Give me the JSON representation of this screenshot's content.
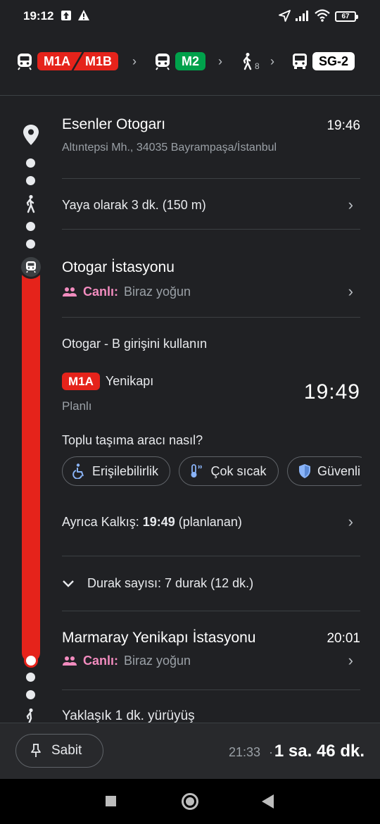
{
  "status_bar": {
    "time": "19:12",
    "battery": "67"
  },
  "route_summary": {
    "lines": [
      {
        "type": "metro",
        "labels": [
          "M1A",
          "M1B"
        ],
        "color": "#e5231b"
      },
      {
        "type": "metro",
        "labels": [
          "M2"
        ],
        "color": "#00a14b"
      },
      {
        "type": "walk",
        "minutes": "8"
      },
      {
        "type": "bus",
        "labels": [
          "SG-2"
        ],
        "color": "#ffffff"
      }
    ]
  },
  "origin": {
    "name": "Esenler Otogarı",
    "address": "Altıntepsi Mh., 34035 Bayrampaşa/İstanbul",
    "time": "19:46"
  },
  "walk_step": {
    "text": "Yaya olarak 3 dk. (150 m)"
  },
  "station": {
    "name": "Otogar İstasyonu",
    "live_label": "Canlı:",
    "live_value": "Biraz yoğun",
    "entrance_note": "Otogar - B girişini kullanın",
    "line_badge": "M1A",
    "direction": "Yenikapı",
    "schedule_state": "Planlı",
    "departure_time": "19:49"
  },
  "vehicle_question": "Toplu taşıma aracı nasıl?",
  "chips": [
    {
      "label": "Erişilebilirlik",
      "icon": "wheelchair-icon"
    },
    {
      "label": "Çok sıcak",
      "icon": "thermometer-icon"
    },
    {
      "label": "Güvenli",
      "icon": "shield-icon"
    }
  ],
  "also_departs": {
    "prefix": "Ayrıca Kalkış: ",
    "time": "19:49",
    "suffix": " (planlanan)"
  },
  "stops": {
    "text": "Durak sayısı: 7 durak (12 dk.)"
  },
  "destination_station": {
    "name": "Marmaray Yenikapı İstasyonu",
    "time": "20:01",
    "live_label": "Canlı:",
    "live_value": "Biraz yoğun"
  },
  "next_walk": {
    "text": "Yaklaşık 1 dk. yürüyüş"
  },
  "bottom_bar": {
    "pin_label": "Sabit",
    "arrival_time": "21:33",
    "separator": "·",
    "duration": "1 sa. 46 dk."
  }
}
